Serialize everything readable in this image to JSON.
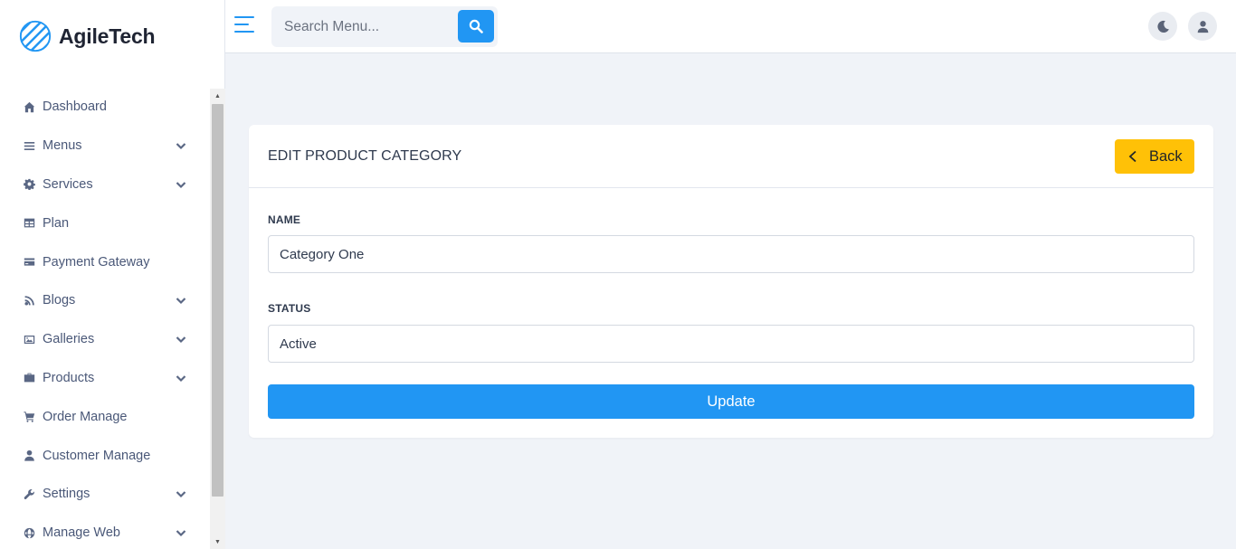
{
  "brand": {
    "name": "AgileTech",
    "accent": "#2196f3"
  },
  "topbar": {
    "search_placeholder": "Search Menu...",
    "icons": [
      "menu-icon",
      "search-icon",
      "moon-icon",
      "user-icon"
    ]
  },
  "sidebar": {
    "items": [
      {
        "label": "Dashboard",
        "icon": "home-icon",
        "has_submenu": false
      },
      {
        "label": "Menus",
        "icon": "bars-icon",
        "has_submenu": true
      },
      {
        "label": "Services",
        "icon": "gear-icon",
        "has_submenu": true
      },
      {
        "label": "Plan",
        "icon": "table-icon",
        "has_submenu": false
      },
      {
        "label": "Payment Gateway",
        "icon": "credit-card-icon",
        "has_submenu": false
      },
      {
        "label": "Blogs",
        "icon": "blog-icon",
        "has_submenu": true
      },
      {
        "label": "Galleries",
        "icon": "image-icon",
        "has_submenu": true
      },
      {
        "label": "Products",
        "icon": "briefcase-icon",
        "has_submenu": true
      },
      {
        "label": "Order Manage",
        "icon": "cart-icon",
        "has_submenu": false
      },
      {
        "label": "Customer Manage",
        "icon": "user-icon",
        "has_submenu": false
      },
      {
        "label": "Settings",
        "icon": "wrench-icon",
        "has_submenu": true
      },
      {
        "label": "Manage Web",
        "icon": "globe-icon",
        "has_submenu": true
      }
    ]
  },
  "card": {
    "title": "EDIT PRODUCT CATEGORY",
    "back_label": "Back",
    "name_label": "NAME",
    "name_value": "Category One",
    "status_label": "STATUS",
    "status_value": "Active",
    "update_label": "Update"
  },
  "colors": {
    "primary": "#2196f3",
    "warning": "#ffc107",
    "background": "#f0f3f8"
  }
}
